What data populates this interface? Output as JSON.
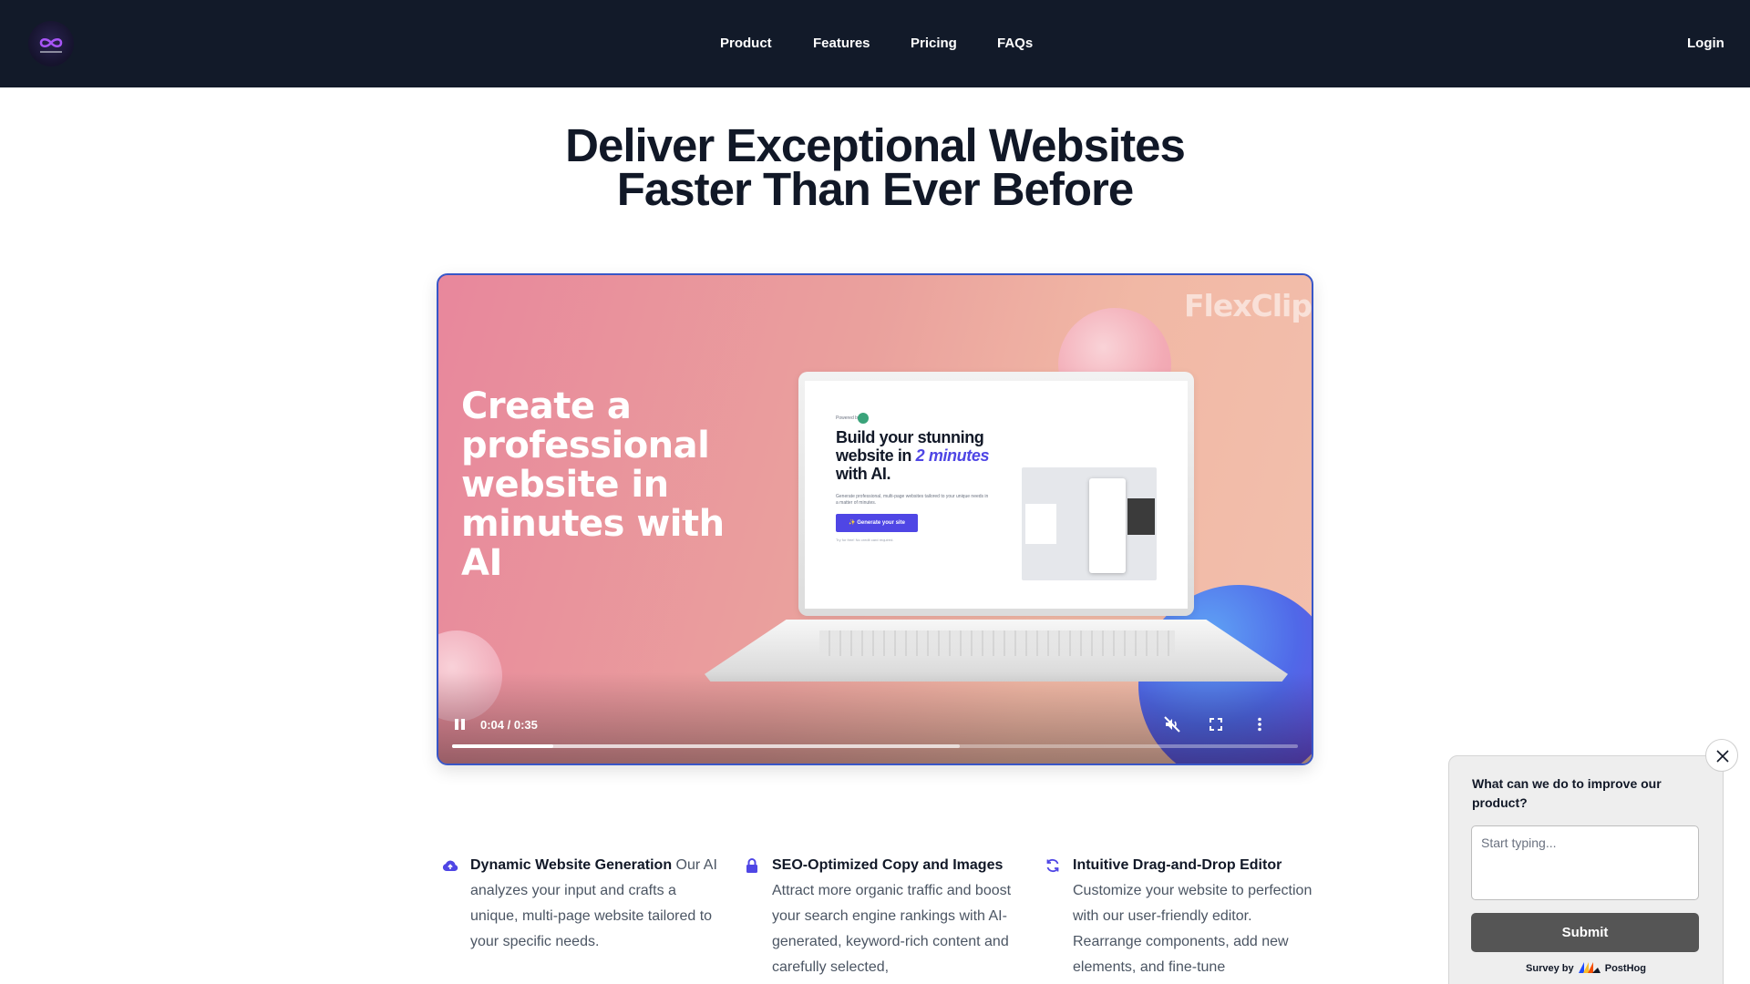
{
  "nav": {
    "logo_icon": "infinity-logo-icon",
    "links": [
      "Product",
      "Features",
      "Pricing",
      "FAQs"
    ],
    "login": "Login"
  },
  "hero": {
    "title_line1": "Deliver Exceptional Websites",
    "title_line2": "Faster Than Ever Before"
  },
  "video": {
    "watermark": "FlexClip",
    "headline": "Create a professional website in minutes with AI",
    "screen": {
      "powered": "Powered by",
      "headline_part1": "Build your stunning website in ",
      "headline_em": "2 minutes",
      "headline_part2": " with AI.",
      "subtext": "Generate professional, multi-page websites tailored to your unique needs in a matter of minutes.",
      "button": "✨ Generate your site",
      "note": "Try for free! No credit card required."
    },
    "time": "0:04 / 0:35",
    "progress_played": 0.12,
    "progress_buffered": 0.6,
    "colors": {
      "accent": "#4f46e5",
      "border": "#3856c7"
    }
  },
  "features": [
    {
      "icon": "cloud-upload-icon",
      "title": "Dynamic Website Generation",
      "text": " Our AI analyzes your input and crafts a unique, multi-page website tailored to your specific needs."
    },
    {
      "icon": "lock-icon",
      "title": "SEO-Optimized Copy and Images",
      "text": " Attract more organic traffic and boost your search engine rankings with AI-generated, keyword-rich content and carefully selected,"
    },
    {
      "icon": "refresh-icon",
      "title": "Intuitive Drag-and-Drop Editor",
      "text": " Customize your website to perfection with our user-friendly editor. Rearrange components, add new elements, and fine-tune"
    }
  ],
  "survey": {
    "question": "What can we do to improve our product?",
    "placeholder": "Start typing...",
    "value": "",
    "submit": "Submit",
    "credit_prefix": "Survey by",
    "credit_brand": "PostHog"
  }
}
